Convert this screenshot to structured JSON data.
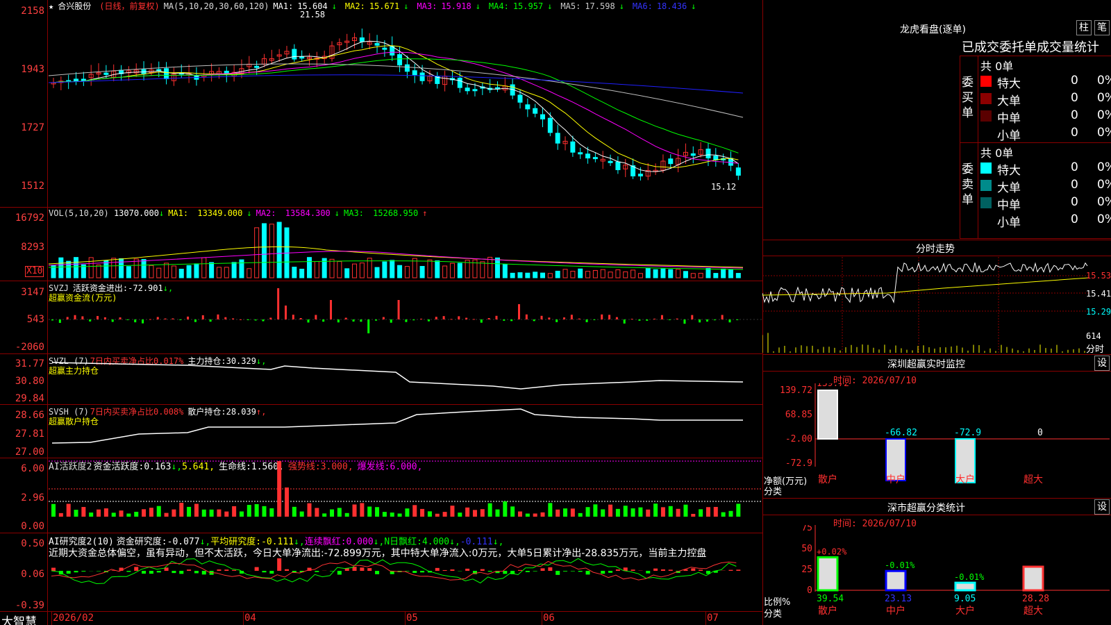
{
  "colors": {
    "up": "#ff3030",
    "down": "#00ffff",
    "ma1": "#ffffff",
    "ma2": "#ffff00",
    "ma3": "#ff00ff",
    "ma4": "#00ff00",
    "ma5": "#c0c0c0",
    "ma6": "#2020ff",
    "grid": "#8b0000",
    "green": "#00ff00"
  },
  "app": {
    "logo": "大智慧"
  },
  "kline": {
    "star": "★",
    "stock": "合兴股份",
    "mode": "(日线，前复权)",
    "ma_def": "MA(5,10,20,30,60,120)",
    "ma": [
      {
        "label": "MA1:",
        "value": "15.604",
        "arrow": "↓"
      },
      {
        "label": "MA2:",
        "value": "15.671",
        "arrow": "↓"
      },
      {
        "label": "MA3:",
        "value": "15.918",
        "arrow": "↓"
      },
      {
        "label": "MA4:",
        "value": "15.957",
        "arrow": "↓"
      },
      {
        "label": "MA5:",
        "value": "17.598",
        "arrow": "↓"
      },
      {
        "label": "MA6:",
        "value": "18.436",
        "arrow": "↓"
      }
    ],
    "yticks": [
      "2158",
      "1943",
      "1727",
      "1512"
    ],
    "high_label": "21.58",
    "low_label": "15.12"
  },
  "vol": {
    "title": "VOL(5,10,20)",
    "value": "13070.000",
    "a1": "↓",
    "ma1": "MA1:",
    "ma1v": "13349.000",
    "a2": "↓",
    "ma2": "MA2:",
    "ma2v": "13584.300",
    "a3": "↓",
    "ma3": "MA3:",
    "ma3v": "15268.950",
    "a4": "↑",
    "yticks": [
      "16792",
      "8293"
    ],
    "unit": "X10"
  },
  "svzj": {
    "title": "SVZJ",
    "label": "活跃资金进出:",
    "value": "-72.901",
    "arrow": "↓,",
    "sub": "超赢资金流(万元)",
    "yticks": [
      "3147",
      "543",
      "-2060"
    ]
  },
  "svzl": {
    "title": "SVZL (7)",
    "ratio": "7日内买卖净占比0.017%",
    "label": "主力持仓:",
    "value": "30.329",
    "arrow": "↓,",
    "sub": "超赢主力持仓",
    "yticks": [
      "31.77",
      "30.80",
      "29.84"
    ]
  },
  "svsh": {
    "title": "SVSH (7)",
    "ratio": "7日内买卖净占比0.008%",
    "label": "散户持仓:",
    "value": "28.039",
    "arrow": "↑,",
    "sub": "超赢散户持仓",
    "yticks": [
      "28.66",
      "27.81",
      "27.00"
    ]
  },
  "ai1": {
    "title": "AI活跃度2",
    "label": "资金活跃度:",
    "value": "0.163",
    "a1": "↓,",
    "v2": "5.641,",
    "life": "生命线:",
    "lifev": "1.560,",
    "strong": "强势线:",
    "strongv": "3.000,",
    "burst": "爆发线:",
    "burstv": "6.000,",
    "yticks": [
      "6.00",
      "2.96",
      "0.00"
    ]
  },
  "ai2": {
    "title": "AI研究度2(10)",
    "label": "资金研究度:",
    "value": "-0.077",
    "a1": "↓,",
    "avg": "平均研究度:",
    "avgv": "-0.111",
    "a2": "↓,",
    "red": "连续飘红:",
    "redv": "0.000",
    "a3": "↓,",
    "nred": "N日飘红:",
    "nredv": "4.000",
    "a4": "↓,",
    "last": "-0.111",
    "a5": "↓,",
    "comment": "近期大资金总体偏空，虽有异动，但不太活跃，今日大单净流出:-72.899万元，其中特大单净流入:0万元，大单5日累计净出-28.835万元，当前主力控盘",
    "yticks": [
      "0.50",
      "0.06",
      "-0.39"
    ]
  },
  "xaxis": [
    "2026/02",
    "04",
    "05",
    "06",
    "07"
  ],
  "right": {
    "lhb": {
      "title": "龙虎看盘(逐单)",
      "btn1": "柱",
      "btn2": "笔",
      "sub": "已成交委托单成交量统计",
      "buy": {
        "side": "委买单",
        "total": "共 0单",
        "rows": [
          {
            "name": "特大",
            "count": "0",
            "pct": "0%",
            "color": "#ff0000"
          },
          {
            "name": "大单",
            "count": "0",
            "pct": "0%",
            "color": "#8b0000"
          },
          {
            "name": "中单",
            "count": "0",
            "pct": "0%",
            "color": "#5a0000"
          },
          {
            "name": "小单",
            "count": "0",
            "pct": "0%",
            "color": "#000000"
          }
        ]
      },
      "sell": {
        "side": "委卖单",
        "total": "共 0单",
        "rows": [
          {
            "name": "特大",
            "count": "0",
            "pct": "0%",
            "color": "#00ffff"
          },
          {
            "name": "大单",
            "count": "0",
            "pct": "0%",
            "color": "#008b8b"
          },
          {
            "name": "中单",
            "count": "0",
            "pct": "0%",
            "color": "#006060"
          },
          {
            "name": "小单",
            "count": "0",
            "pct": "0%",
            "color": "#000000"
          }
        ]
      }
    },
    "fenshi": {
      "title": "分时走势",
      "p1": "15.53",
      "p2": "15.41",
      "p3": "15.29",
      "v1": "614",
      "v2": "分时"
    },
    "sz": {
      "title": "深圳超赢实时监控",
      "btn": "设",
      "time": "时间: 2026/07/10",
      "yticks": [
        "139.72",
        "68.85",
        "-2.00",
        "-72.9"
      ],
      "ylabel": "净额(万元)",
      "xlabel": "分类",
      "bars": [
        {
          "cat": "散户",
          "val": "139.72"
        },
        {
          "cat": "中户",
          "val": "-66.82"
        },
        {
          "cat": "大户",
          "val": "-72.9"
        },
        {
          "cat": "超大",
          "val": "0"
        }
      ]
    },
    "szc": {
      "title": "深市超赢分类统计",
      "btn": "设",
      "time": "时间: 2026/07/10",
      "yticks": [
        "75",
        "50",
        "25",
        "0"
      ],
      "ylabel": "比例%",
      "xlabel": "分类",
      "bars": [
        {
          "cat": "散户",
          "top": "+0.02%",
          "bot": "39.54",
          "v": 39.54
        },
        {
          "cat": "中户",
          "top": "-0.01%",
          "bot": "23.13",
          "v": 23.13
        },
        {
          "cat": "大户",
          "top": "-0.01%",
          "bot": "9.05",
          "v": 9.05
        },
        {
          "cat": "超大",
          "top": "",
          "bot": "28.28",
          "v": 28.28
        }
      ]
    }
  },
  "chart_data": {
    "type": "candlestick",
    "ticks": [
      "2158",
      "1943",
      "1727",
      "1512"
    ],
    "high": 21.58,
    "low": 15.12
  }
}
